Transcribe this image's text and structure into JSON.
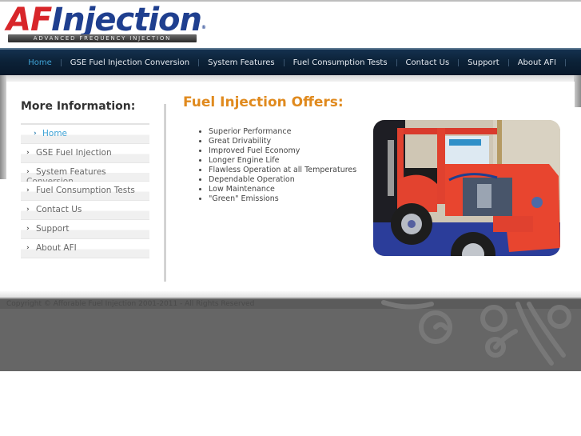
{
  "header": {
    "logo": {
      "brand_red": "AF",
      "brand_blue": "Injection",
      "registered": "®",
      "tagline": "ADVANCED FREQUENCY INJECTION"
    }
  },
  "nav": {
    "items": [
      {
        "label": "Home",
        "active": true
      },
      {
        "label": "GSE Fuel Injection Conversion"
      },
      {
        "label": "System Features"
      },
      {
        "label": "Fuel Consumption Tests"
      },
      {
        "label": "Contact Us"
      },
      {
        "label": "Support"
      },
      {
        "label": "About AFI"
      }
    ]
  },
  "sidebar": {
    "title": "More Information:",
    "chevron": "›",
    "items": [
      {
        "label": "Home",
        "active": true
      },
      {
        "label": "GSE Fuel Injection",
        "overflow": "Conversion"
      },
      {
        "label": "System Features"
      },
      {
        "label": "Fuel Consumption Tests"
      },
      {
        "label": "Contact Us"
      },
      {
        "label": "Support"
      },
      {
        "label": "About AFI"
      }
    ]
  },
  "main": {
    "title": "Fuel Injection Offers:",
    "offers": [
      "Superior Performance",
      "Great Drivability",
      "Improved Fuel Economy",
      "Longer Engine Life",
      "Flawless Operation at all Temperatures",
      "Dependable Operation",
      "Low Maintenance",
      "\"Green\" Emissions"
    ],
    "photo_alt": "Red ground support tractor with fuel injection conversion"
  },
  "footer": {
    "copyright": "Copyright © Afforable Fuel Injection 2001-2011 - All Rights Reserved"
  },
  "colors": {
    "accent_orange": "#e08a1e",
    "active_blue": "#3fa3d6",
    "nav_bg": "#0c2238",
    "footer_bg": "#666666",
    "logo_red": "#d8262a",
    "logo_blue": "#1f3f8f"
  }
}
